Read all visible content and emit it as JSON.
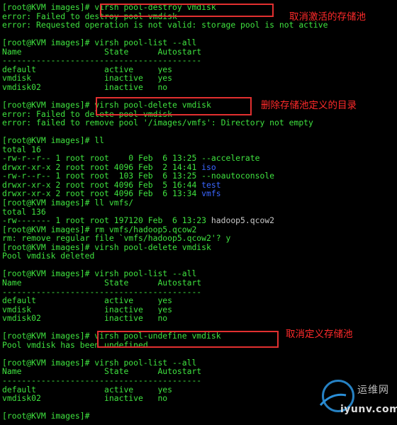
{
  "terminal": {
    "lines": [
      [
        {
          "text": "[root@KVM images]# virsh pool-destroy vmdisk",
          "color": "green"
        }
      ],
      [
        {
          "text": "error: Failed to destroy pool vmdisk",
          "color": "green"
        }
      ],
      [
        {
          "text": "error: Requested operation is not valid: storage pool is not active",
          "color": "green"
        }
      ],
      [
        {
          "text": "",
          "color": "green"
        }
      ],
      [
        {
          "text": "[root@KVM images]# virsh pool-list --all",
          "color": "green"
        }
      ],
      [
        {
          "text": "Name                 State      Autostart",
          "color": "green"
        }
      ],
      [
        {
          "text": "-----------------------------------------",
          "color": "green"
        }
      ],
      [
        {
          "text": "default              active     yes",
          "color": "green"
        }
      ],
      [
        {
          "text": "vmdisk               inactive   yes",
          "color": "green"
        }
      ],
      [
        {
          "text": "vmdisk02             inactive   no",
          "color": "green"
        }
      ],
      [
        {
          "text": "",
          "color": "green"
        }
      ],
      [
        {
          "text": "[root@KVM images]# virsh pool-delete vmdisk",
          "color": "green"
        }
      ],
      [
        {
          "text": "error: Failed to delete pool vmdisk",
          "color": "green"
        }
      ],
      [
        {
          "text": "error: failed to remove pool '/images/vmfs': Directory not empty",
          "color": "green"
        }
      ],
      [
        {
          "text": "",
          "color": "green"
        }
      ],
      [
        {
          "text": "[root@KVM images]# ll",
          "color": "green"
        }
      ],
      [
        {
          "text": "total 16",
          "color": "green"
        }
      ],
      [
        {
          "text": "-rw-r--r-- 1 root root    0 Feb  6 13:25 --accelerate",
          "color": "green"
        }
      ],
      [
        {
          "text": "drwxr-xr-x 2 root root 4096 Feb  2 14:41 ",
          "color": "green"
        },
        {
          "text": "iso",
          "color": "blue"
        }
      ],
      [
        {
          "text": "-rw-r--r-- 1 root root  103 Feb  6 13:25 --noautoconsole",
          "color": "green"
        }
      ],
      [
        {
          "text": "drwxr-xr-x 2 root root 4096 Feb  5 16:44 ",
          "color": "green"
        },
        {
          "text": "test",
          "color": "blue"
        }
      ],
      [
        {
          "text": "drwxr-xr-x 2 root root 4096 Feb  6 13:34 ",
          "color": "green"
        },
        {
          "text": "vmfs",
          "color": "blue"
        }
      ],
      [
        {
          "text": "[root@KVM images]# ll vmfs/",
          "color": "green"
        }
      ],
      [
        {
          "text": "total 136",
          "color": "green"
        }
      ],
      [
        {
          "text": "-rw------- 1 root root 197120 Feb  6 13:23 ",
          "color": "green"
        },
        {
          "text": "hadoop5.qcow2",
          "color": "gray"
        }
      ],
      [
        {
          "text": "[root@KVM images]# rm vmfs/hadoop5.qcow2",
          "color": "green"
        }
      ],
      [
        {
          "text": "rm: remove regular file `vmfs/hadoop5.qcow2'? y",
          "color": "green"
        }
      ],
      [
        {
          "text": "[root@KVM images]# virsh pool-delete vmdisk",
          "color": "green"
        }
      ],
      [
        {
          "text": "Pool vmdisk deleted",
          "color": "green"
        }
      ],
      [
        {
          "text": "",
          "color": "green"
        }
      ],
      [
        {
          "text": "[root@KVM images]# virsh pool-list --all",
          "color": "green"
        }
      ],
      [
        {
          "text": "Name                 State      Autostart",
          "color": "green"
        }
      ],
      [
        {
          "text": "-----------------------------------------",
          "color": "green"
        }
      ],
      [
        {
          "text": "default              active     yes",
          "color": "green"
        }
      ],
      [
        {
          "text": "vmdisk               inactive   yes",
          "color": "green"
        }
      ],
      [
        {
          "text": "vmdisk02             inactive   no",
          "color": "green"
        }
      ],
      [
        {
          "text": "",
          "color": "green"
        }
      ],
      [
        {
          "text": "[root@KVM images]# virsh pool-undefine vmdisk",
          "color": "green"
        }
      ],
      [
        {
          "text": "Pool vmdisk has been undefined",
          "color": "green"
        }
      ],
      [
        {
          "text": "",
          "color": "green"
        }
      ],
      [
        {
          "text": "[root@KVM images]# virsh pool-list --all",
          "color": "green"
        }
      ],
      [
        {
          "text": "Name                 State      Autostart",
          "color": "green"
        }
      ],
      [
        {
          "text": "-----------------------------------------",
          "color": "green"
        }
      ],
      [
        {
          "text": "default              active     yes",
          "color": "green"
        }
      ],
      [
        {
          "text": "vmdisk02             inactive   no",
          "color": "green"
        }
      ],
      [
        {
          "text": "",
          "color": "green"
        }
      ],
      [
        {
          "text": "[root@KVM images]# ",
          "color": "green"
        }
      ]
    ]
  },
  "annotations": [
    {
      "id": "destroy",
      "label": "取消激活的存储池"
    },
    {
      "id": "delete",
      "label": "删除存储池定义的目录"
    },
    {
      "id": "undefine",
      "label": "取消定义存储池"
    }
  ],
  "watermark": {
    "top_text": "运维网",
    "bottom_text": "iyunv.com"
  },
  "colors": {
    "background": "#000000",
    "green": "#3fe23f",
    "blue": "#3a66ff",
    "gray": "#c8c8c8",
    "callout": "#e23030",
    "watermark_blue": "#2a8fd8"
  }
}
